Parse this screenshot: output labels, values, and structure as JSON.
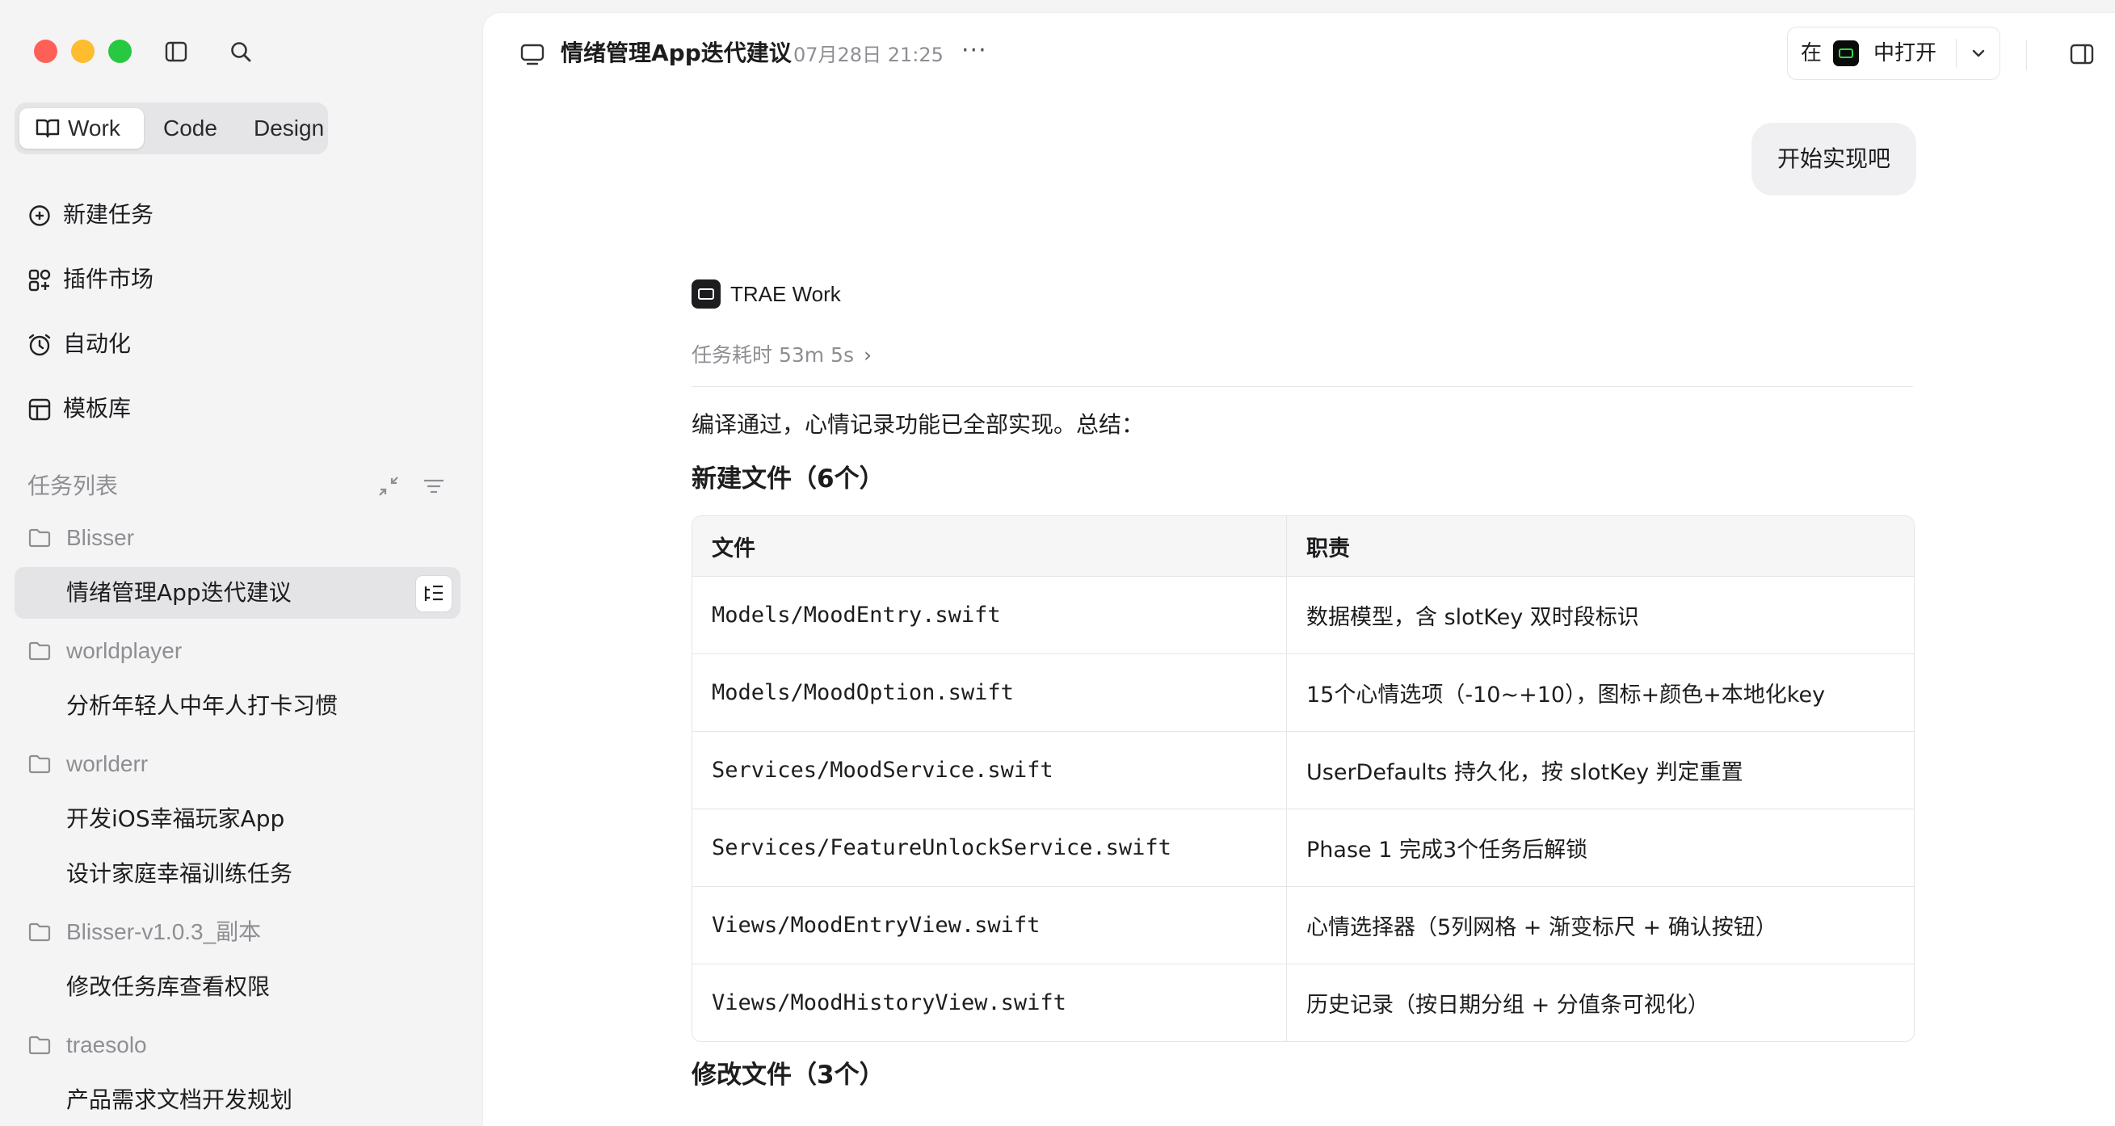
{
  "sidebar": {
    "modes": [
      {
        "label": "Work",
        "active": true
      },
      {
        "label": "Code",
        "active": false
      },
      {
        "label": "Design",
        "active": false
      }
    ],
    "nav": [
      {
        "label": "新建任务",
        "icon": "new-task-icon"
      },
      {
        "label": "插件市场",
        "icon": "plugin-market-icon"
      },
      {
        "label": "自动化",
        "icon": "automation-clock-icon"
      },
      {
        "label": "模板库",
        "icon": "template-library-icon"
      }
    ],
    "task_list_title": "任务列表",
    "groups": [
      {
        "name": "Blisser",
        "tasks": [
          "情绪管理App迭代建议"
        ]
      },
      {
        "name": "worldplayer",
        "tasks": [
          "分析年轻人中年人打卡习惯"
        ]
      },
      {
        "name": "worlderr",
        "tasks": [
          "开发iOS幸福玩家App",
          "设计家庭幸福训练任务"
        ]
      },
      {
        "name": "Blisser-v1.0.3_副本",
        "tasks": [
          "修改任务库查看权限"
        ]
      },
      {
        "name": "traesolo",
        "tasks": [
          "产品需求文档开发规划"
        ]
      }
    ]
  },
  "header": {
    "title": "情绪管理App迭代建议",
    "date": "07月28日 21:25",
    "more": "···",
    "open_in_prefix": "在",
    "open_in_suffix": "中打开"
  },
  "chat": {
    "user_message": "开始实现吧",
    "agent_name": "TRAE Work",
    "duration": "任务耗时 53m 5s",
    "duration_arrow": "›",
    "summary": "编译通过，心情记录功能已全部实现。总结：",
    "new_files_heading": "新建文件（6个）",
    "table": {
      "headers": [
        "文件",
        "职责"
      ],
      "rows": [
        [
          "Models/MoodEntry.swift",
          "数据模型，含 slotKey 双时段标识"
        ],
        [
          "Models/MoodOption.swift",
          "15个心情选项（-10~+10），图标+颜色+本地化key"
        ],
        [
          "Services/MoodService.swift",
          "UserDefaults 持久化，按 slotKey 判定重置"
        ],
        [
          "Services/FeatureUnlockService.swift",
          "Phase 1 完成3个任务后解锁"
        ],
        [
          "Views/MoodEntryView.swift",
          "心情选择器（5列网格 + 渐变标尺 + 确认按钮）"
        ],
        [
          "Views/MoodHistoryView.swift",
          "历史记录（按日期分组 + 分值条可视化）"
        ]
      ]
    },
    "modified_files_heading": "修改文件（3个）"
  },
  "colors": {
    "traffic_red": "#fe5f57",
    "traffic_yellow": "#febc2e",
    "traffic_green": "#28c840",
    "terminal_accent": "#32d74b"
  }
}
